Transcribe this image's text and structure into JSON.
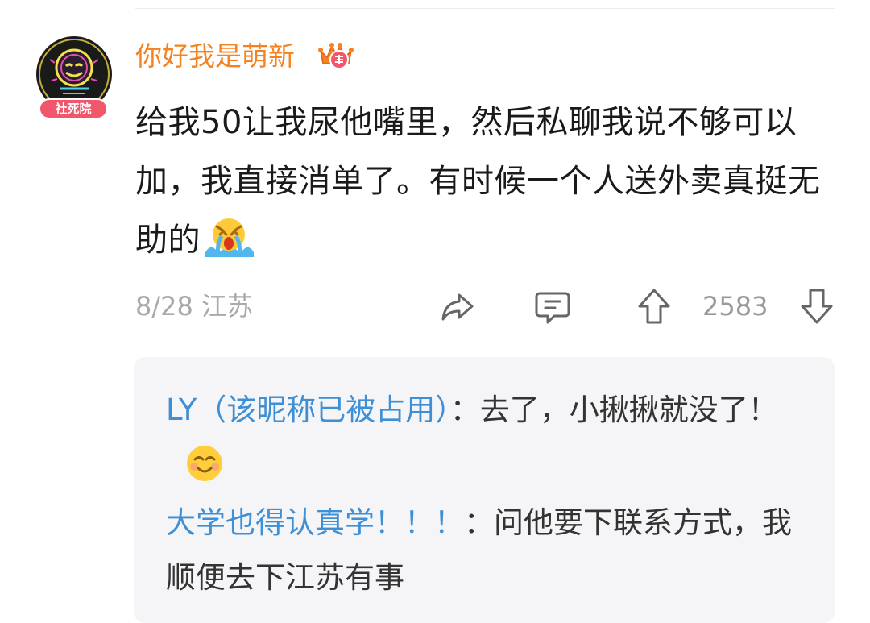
{
  "comment": {
    "username": "你好我是萌新",
    "avatar_badge": "社死院",
    "vip_icon": "crown-year-icon",
    "text": "给我50让我尿他嘴里，然后私聊我说不够可以加，我直接消单了。有时候一个人送外卖真挺无助的",
    "emoji": "crying-face-emoji",
    "date": "8/28",
    "location": "江苏",
    "vote_count": "2583",
    "icons": [
      "share-icon",
      "comment-icon",
      "upvote-icon",
      "downvote-icon"
    ]
  },
  "replies": [
    {
      "author": "LY（该昵称已被占用）",
      "separator": "：",
      "text": "去了，小揪揪就没了！",
      "emoji": "smiling-face-emoji"
    },
    {
      "author": "大学也得认真学！！！",
      "separator": "：",
      "text": "问他要下联系方式，我顺便去下江苏有事"
    }
  ],
  "colors": {
    "username": "#f5821f",
    "reply_author": "#3d8fd6",
    "meta": "#a9a9a9",
    "reply_bg": "#f5f5f7"
  }
}
